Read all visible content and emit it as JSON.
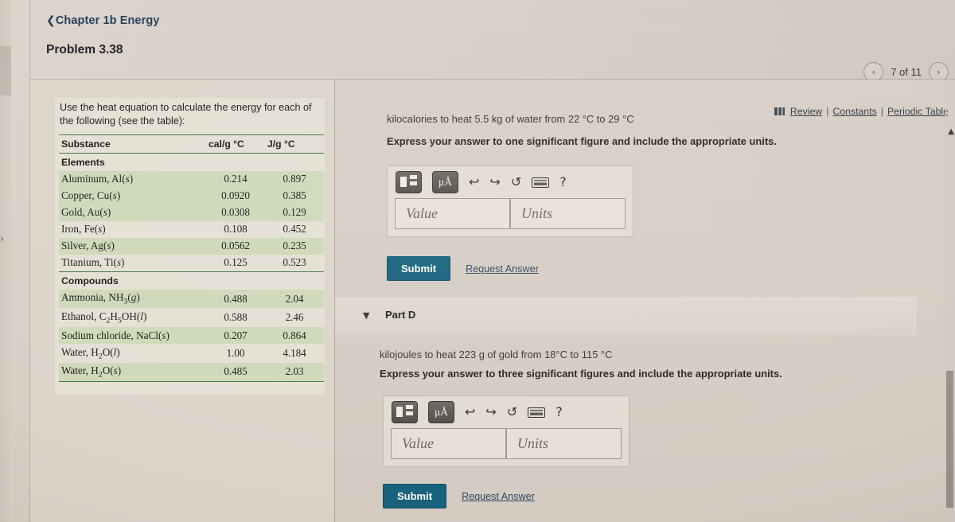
{
  "breadcrumb": {
    "back_icon": "chevron-left-icon",
    "label": "Chapter 1b Energy"
  },
  "problem_title": "Problem 3.38",
  "pager": {
    "prev_icon": "‹",
    "next_icon": "›",
    "label": "7 of 11"
  },
  "tool_links": {
    "book_icon": "book-icon",
    "review": "Review",
    "sep1": "|",
    "constants": "Constants",
    "sep2": "|",
    "periodic_table": "Periodic Table"
  },
  "textbook": {
    "intro": "Use the heat equation to calculate the energy for each of the following (see the table):",
    "table": {
      "headers": [
        "Substance",
        "cal/g °C",
        "J/g °C"
      ],
      "groups": [
        {
          "name": "Elements",
          "rows": [
            {
              "substance": "Aluminum, Al",
              "state": "s",
              "cal": "0.214",
              "joule": "0.897"
            },
            {
              "substance": "Copper, Cu",
              "state": "s",
              "cal": "0.0920",
              "joule": "0.385"
            },
            {
              "substance": "Gold, Au",
              "state": "s",
              "cal": "0.0308",
              "joule": "0.129"
            },
            {
              "substance": "Iron, Fe",
              "state": "s",
              "cal": "0.108",
              "joule": "0.452"
            },
            {
              "substance": "Silver, Ag",
              "state": "s",
              "cal": "0.0562",
              "joule": "0.235"
            },
            {
              "substance": "Titanium, Ti",
              "state": "s",
              "cal": "0.125",
              "joule": "0.523"
            }
          ]
        },
        {
          "name": "Compounds",
          "rows": [
            {
              "substance": "Ammonia, NH3",
              "state": "g",
              "cal": "0.488",
              "joule": "2.04"
            },
            {
              "substance": "Ethanol, C2H5OH",
              "state": "l",
              "cal": "0.588",
              "joule": "2.46"
            },
            {
              "substance": "Sodium chloride, NaCl",
              "state": "s",
              "cal": "0.207",
              "joule": "0.864"
            },
            {
              "substance": "Water, H2O",
              "state": "l",
              "cal": "1.00",
              "joule": "4.184"
            },
            {
              "substance": "Water, H2O",
              "state": "s",
              "cal": "0.485",
              "joule": "2.03"
            }
          ]
        }
      ]
    }
  },
  "part_c": {
    "question": "kilocalories to heat 5.5 kg of water from 22 °C to 29 °C",
    "instruction": "Express your answer to one significant figure and include the appropriate units.",
    "toolbar": {
      "template_icon": "answer-template-icon",
      "units_icon": "μÅ",
      "undo_icon": "↩",
      "redo_icon": "↪",
      "reset_icon": "↺",
      "keyboard_icon": "keyboard-icon",
      "help_icon": "?"
    },
    "value_placeholder": "Value",
    "units_placeholder": "Units",
    "value": "",
    "units": "",
    "submit_label": "Submit",
    "request_answer_label": "Request Answer"
  },
  "part_d": {
    "caret_icon": "▼",
    "label": "Part D",
    "question": "kilojoules to heat 223 g of gold from 18°C to 115 °C",
    "instruction": "Express your answer to three significant figures and include the appropriate units.",
    "toolbar": {
      "template_icon": "answer-template-icon",
      "units_icon": "μÅ",
      "undo_icon": "↩",
      "redo_icon": "↪",
      "reset_icon": "↺",
      "keyboard_icon": "keyboard-icon",
      "help_icon": "?"
    },
    "value_placeholder": "Value",
    "units_placeholder": "Units",
    "value": "",
    "units": "",
    "submit_label": "Submit",
    "request_answer_label": "Request Answer"
  },
  "colors": {
    "page_background": "#d5cbc2",
    "submit_blue": "#18627d",
    "table_rule_green": "#3f7a4a",
    "table_shade_green": "#cfd9b9",
    "link_blue": "#2f4a63"
  }
}
